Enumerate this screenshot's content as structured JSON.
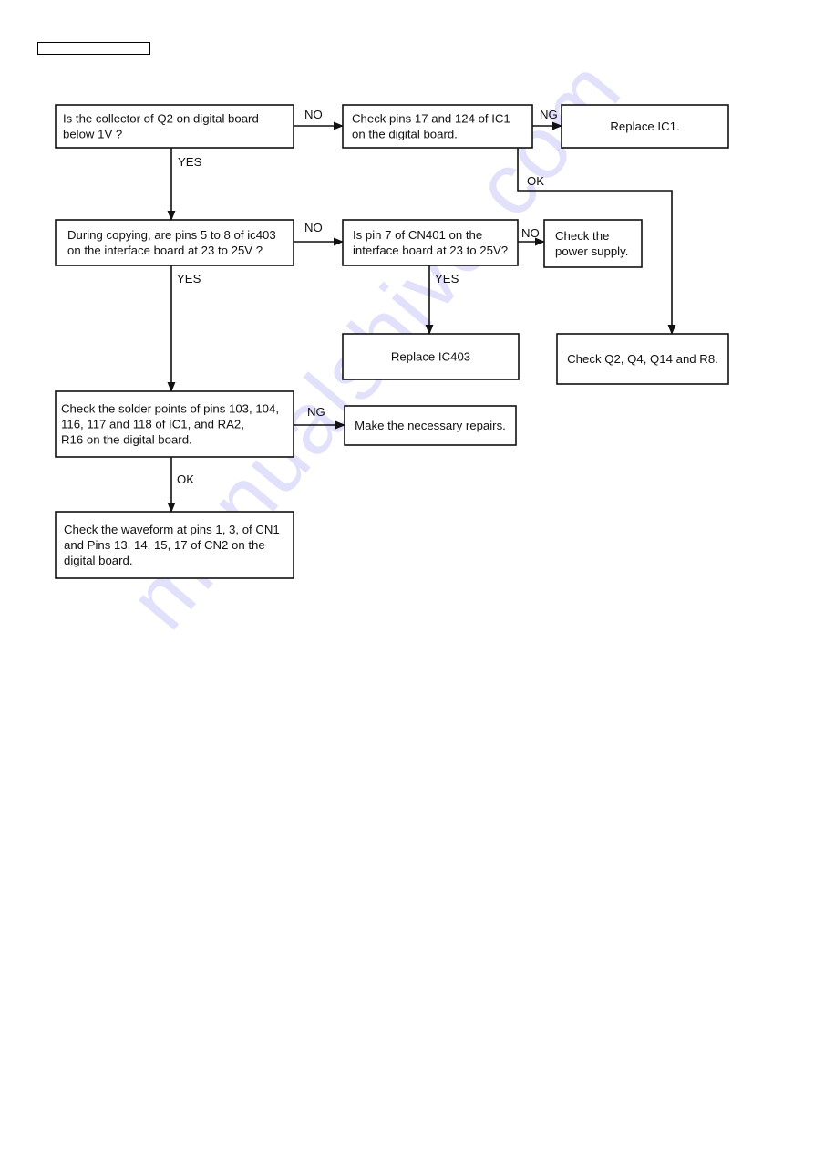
{
  "header": {
    "label": ""
  },
  "watermark": {
    "text": "manualshive.com"
  },
  "nodes": [
    {
      "id": "q2-collector",
      "lines": [
        "Is the collector of Q2 on digital board",
        "below 1V ?"
      ]
    },
    {
      "id": "check-ic1-pins",
      "lines": [
        "Check pins 17 and 124 of IC1",
        "on the digital board."
      ]
    },
    {
      "id": "replace-ic1",
      "lines": [
        "Replace IC1."
      ]
    },
    {
      "id": "ic403-pins",
      "lines": [
        "During copying, are pins 5 to 8 of ic403",
        "on the interface board at 23 to 25V ?"
      ]
    },
    {
      "id": "cn401-pin7",
      "lines": [
        "Is pin 7 of CN401 on the",
        "interface board at 23 to 25V?"
      ]
    },
    {
      "id": "check-power",
      "lines": [
        "Check the",
        "power supply."
      ]
    },
    {
      "id": "replace-ic403",
      "lines": [
        "Replace IC403"
      ]
    },
    {
      "id": "check-q2-q4",
      "lines": [
        "Check Q2, Q4, Q14 and R8."
      ]
    },
    {
      "id": "solder-points",
      "lines": [
        "Check the solder points of pins 103, 104,",
        "116, 117 and 118 of IC1, and RA2,",
        "R16 on the digital board."
      ]
    },
    {
      "id": "necessary-repairs",
      "lines": [
        "Make the necessary repairs."
      ]
    },
    {
      "id": "waveform",
      "lines": [
        "Check the waveform at pins 1, 3, of CN1",
        "and Pins 13, 14, 15, 17 of CN2 on the",
        "digital board."
      ]
    }
  ],
  "edges": [
    {
      "from": "q2-collector",
      "to": "check-ic1-pins",
      "label": "NO"
    },
    {
      "from": "check-ic1-pins",
      "to": "replace-ic1",
      "label": "NG"
    },
    {
      "from": "check-ic1-pins",
      "to": "check-q2-q4",
      "label": "OK"
    },
    {
      "from": "q2-collector",
      "to": "ic403-pins",
      "label": "YES"
    },
    {
      "from": "ic403-pins",
      "to": "cn401-pin7",
      "label": "NO"
    },
    {
      "from": "cn401-pin7",
      "to": "check-power",
      "label": "NO"
    },
    {
      "from": "cn401-pin7",
      "to": "replace-ic403",
      "label": "YES"
    },
    {
      "from": "ic403-pins",
      "to": "solder-points",
      "label": "YES"
    },
    {
      "from": "solder-points",
      "to": "necessary-repairs",
      "label": "NG"
    },
    {
      "from": "solder-points",
      "to": "waveform",
      "label": "OK"
    }
  ]
}
